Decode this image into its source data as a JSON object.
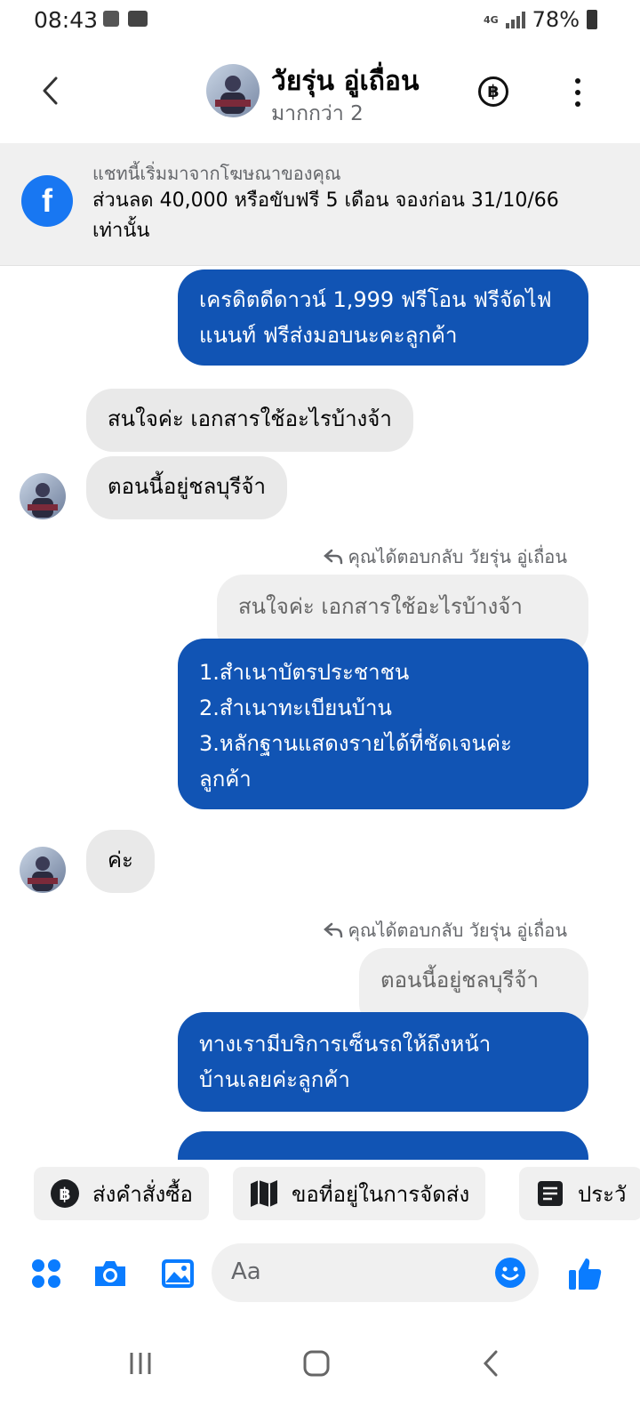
{
  "status_bar": {
    "time": "08:43",
    "network": "4G",
    "battery": "78%"
  },
  "header": {
    "name": "วัยรุ่น อู่เถื่อน",
    "subtitle": "มากกว่า 2",
    "currency_symbol": "฿"
  },
  "ad_banner": {
    "intro": "แชทนี้เริ่มมาจากโฆษณาของคุณ",
    "text": "ส่วนลด 40,000 หรือขับฟรี 5 เดือน จองก่อน 31/10/66 เท่านั้น"
  },
  "messages": {
    "m1": {
      "direction": "out",
      "text": "เครดิตดีดาวน์ 1,999 ฟรีโอน ฟรีจัดไฟแนนท์ ฟรีส่งมอบนะคะลูกค้า"
    },
    "m2": {
      "direction": "in",
      "text": "สนใจค่ะ เอกสารใช้อะไรบ้างจ้า"
    },
    "m3": {
      "direction": "in",
      "text": "ตอนนี้อยู่ชลบุรีจ้า"
    },
    "r1": {
      "note": "คุณได้ตอบกลับ วัยรุ่น อู่เถื่อน",
      "quoted": "สนใจค่ะ เอกสารใช้อะไรบ้างจ้า"
    },
    "m4": {
      "direction": "out",
      "lines": [
        "1.สำเนาบัตรประชาชน",
        "2.สำเนาทะเบียนบ้าน",
        "3.หลักฐานแสดงรายได้ที่ชัดเจนค่ะ",
        "ลูกค้า"
      ]
    },
    "m5": {
      "direction": "in",
      "text": "ค่ะ"
    },
    "r2": {
      "note": "คุณได้ตอบกลับ วัยรุ่น อู่เถื่อน",
      "quoted": "ตอนนี้อยู่ชลบุรีจ้า"
    },
    "m6": {
      "direction": "out",
      "lines": [
        "ทางเรามีบริการเซ็นรถให้ถึงหน้า",
        "บ้านเลยค่ะลูกค้า"
      ]
    }
  },
  "quick_replies": [
    {
      "label": "ส่งคำสั่งซื้อ",
      "icon": "baht-circle-icon"
    },
    {
      "label": "ขอที่อยู่ในการจัดส่ง",
      "icon": "map-icon"
    },
    {
      "label": "ประวั",
      "icon": "document-icon"
    }
  ],
  "composer": {
    "placeholder": "Aa"
  },
  "colors": {
    "outgoing": "#1154b4",
    "incoming": "#e9e9e9",
    "brand": "#1877f2"
  }
}
